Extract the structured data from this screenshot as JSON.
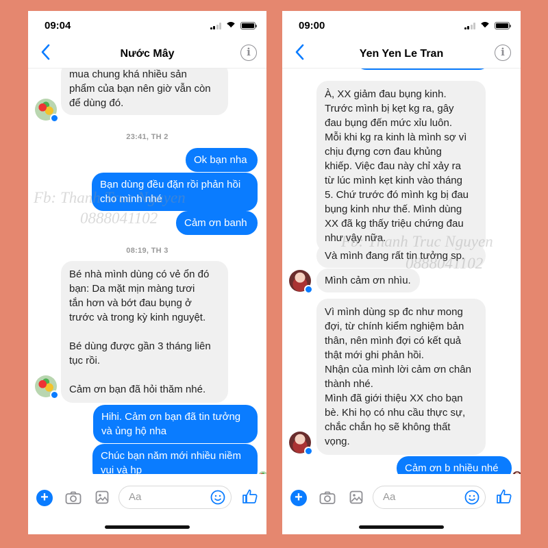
{
  "watermark": {
    "name": "Fb: Thanh Truc Nguyen",
    "phone": "0888041102"
  },
  "left_phone": {
    "time": "09:04",
    "contact_name": "Nước Mây",
    "messages": [
      {
        "text": "mua chung khá nhiều sản\nphẩm của bạn nên giờ vẫn còn\nđể dùng đó."
      },
      {
        "timestamp": "23:41, TH 2"
      },
      {
        "text": "Ok bạn nha"
      },
      {
        "text": "Bạn dùng đều đặn rồi phản hồi\ncho mình nhé"
      },
      {
        "text": "Cảm ơn banh"
      },
      {
        "timestamp": "08:19, TH 3"
      },
      {
        "text": "Bé nhà mình dùng có vẻ ổn đó\nbạn:   Da mặt mịn màng tươi\ntắn hơn và bớt đau bụng ở\ntrước và trong kỳ kinh nguyệt.\n\nBé dùng được gần 3 tháng liên\ntục rồi.\n\nCảm ơn bạn đã hỏi thăm nhé."
      },
      {
        "text": "Hihi. Cảm ơn bạn đã tin tưởng\nvà ủng hộ nha"
      },
      {
        "text": "Chúc bạn năm mới nhiều niềm\nvui và hp"
      }
    ],
    "composer_placeholder": "Aa"
  },
  "right_phone": {
    "time": "09:00",
    "contact_name": "Yen Yen Le Tran",
    "messages": [
      {
        "text": "À, XX giảm đau bụng kinh.\nTrước mình bị kẹt kg ra, gây\nđau bụng đến mức xỉu luôn.\nMỗi khi kg ra kinh là mình sợ vì\nchịu đựng cơn đau khủng\nkhiếp. Việc đau này chỉ xảy ra\ntừ lúc mình kẹt kinh vào tháng\n5. Chứ trước đó mình kg bị đau\nbụng kinh như thế. Mình dùng\nXX đã kg thấy triệu chứng đau\nnhư vậy nữa."
      },
      {
        "text": "Và mình đang rất tin tưởng sp."
      },
      {
        "text": "Mình cảm ơn nhìu."
      },
      {
        "text": "Vì mình dùng sp đc như mong\nđợi, từ chính kiểm nghiệm bản\nthân, nên mình đợi có kết quả\nthật mới ghi phản hồi.\nNhận của mình lời cảm ơn chân\nthành nhé.\nMình đã giới thiệu XX cho bạn\nbè. Khi họ có nhu cầu thực sự,\nchắc chắn họ sẽ không thất\nvọng."
      },
      {
        "text": "Cảm ơn b nhiều nhé"
      }
    ],
    "composer_placeholder": "Aa"
  }
}
